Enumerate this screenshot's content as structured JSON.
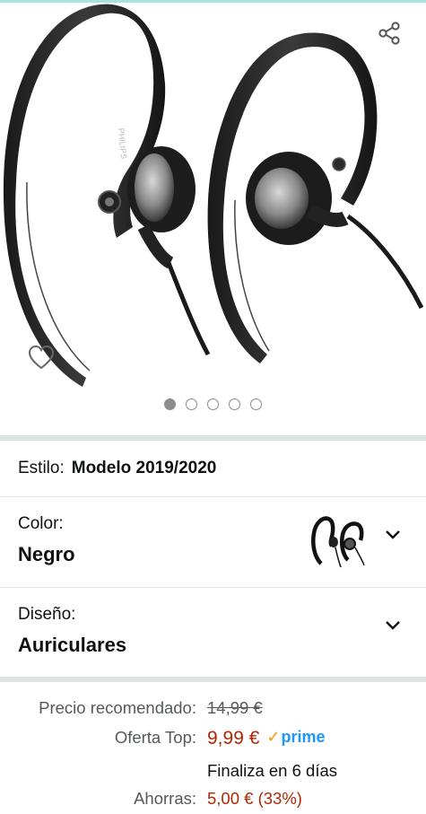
{
  "gallery": {
    "brand_on_product": "PHILIPS",
    "image_count": 5,
    "active_index": 0
  },
  "style": {
    "label": "Estilo:",
    "value": "Modelo 2019/2020"
  },
  "color": {
    "label": "Color:",
    "value": "Negro"
  },
  "design": {
    "label": "Diseño:",
    "value": "Auriculares"
  },
  "pricing": {
    "list_label": "Precio recomendado:",
    "list_price": "14,99 €",
    "deal_label": "Oferta Top:",
    "deal_price": "9,99 €",
    "prime_label": "prime",
    "ends_text": "Finaliza en 6 días",
    "savings_label": "Ahorras:",
    "savings_value": "5,00 € (33%)"
  },
  "colors": {
    "price_red": "#b12704",
    "prime_blue": "#1a98ff",
    "prime_check": "#f79400",
    "top_accent": "#a6e3e2"
  }
}
